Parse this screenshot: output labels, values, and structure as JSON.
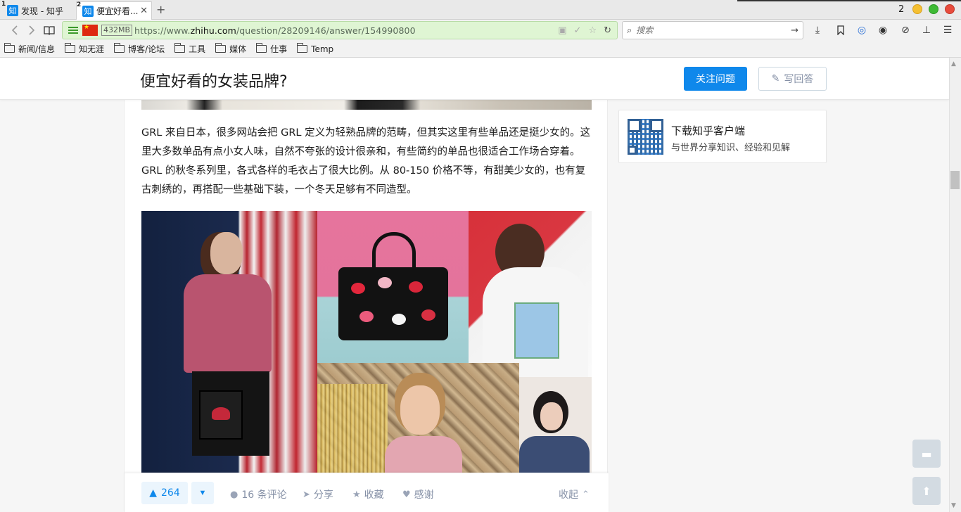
{
  "browser": {
    "tabs": [
      {
        "number": "1",
        "favicon": "知",
        "title": "发现 - 知乎"
      },
      {
        "number": "2",
        "favicon": "知",
        "title": "便宜好看..."
      }
    ],
    "new_tab_symbol": "+",
    "window_count": "2",
    "memory_badge": "432MB",
    "url_prefix": "https://www.",
    "url_domain": "zhihu.com",
    "url_path": "/question/28209146/answer/154990800",
    "search_placeholder": "搜索",
    "bookmarks": [
      "新闻/信息",
      "知无涯",
      "博客/论坛",
      "工具",
      "媒体",
      "仕事",
      "Temp"
    ]
  },
  "question": {
    "title": "便宜好看的女装品牌?",
    "follow_label": "关注问题",
    "write_label": "写回答"
  },
  "answer": {
    "paragraph": "GRL 来自日本，很多网站会把 GRL 定义为轻熟品牌的范畴，但其实这里有些单品还是挺少女的。这里大多数单品有点小女人味，自然不夸张的设计很亲和，有些简约的单品也很适合工作场合穿着。GRL 的秋冬系列里，各式各样的毛衣占了很大比例。从 80-150 价格不等，有甜美少女的，也有复古刺绣的，再搭配一些基础下装，一个冬天足够有不同造型。",
    "votes": "264",
    "comments": "16 条评论",
    "share": "分享",
    "favorite": "收藏",
    "thanks": "感谢",
    "collapse": "收起"
  },
  "sidebar": {
    "app_title": "下载知乎客户端",
    "app_subtitle": "与世界分享知识、经验和见解"
  },
  "colors": {
    "brand_blue": "#0f88eb",
    "url_bar_green": "#dff5d3"
  }
}
